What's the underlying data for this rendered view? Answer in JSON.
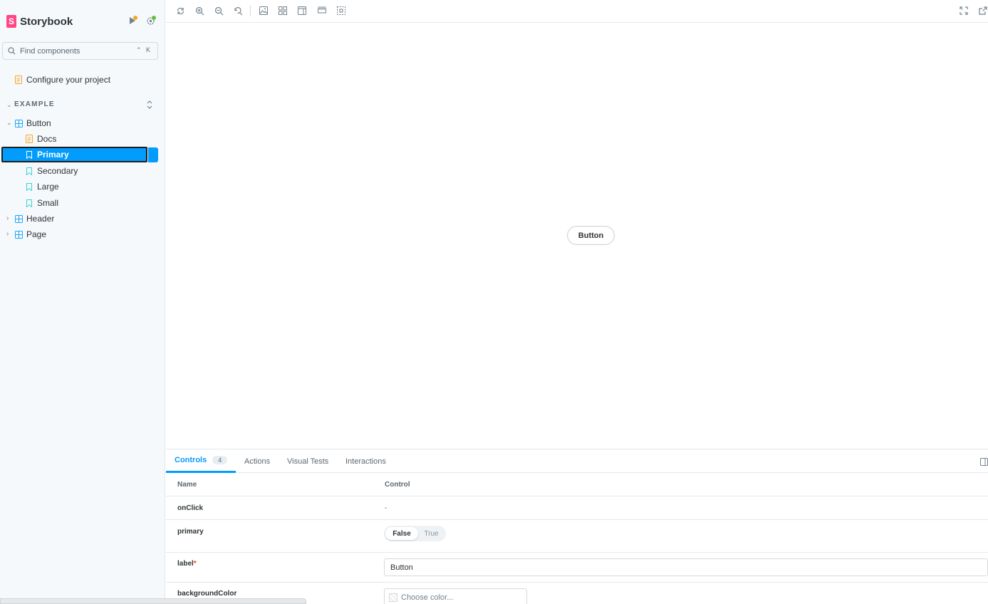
{
  "brand": {
    "name": "Storybook",
    "logo_letter": "S",
    "accent": "#ff4785"
  },
  "search": {
    "placeholder": "Find components",
    "shortcut": "⌃ K"
  },
  "sidebar": {
    "configure_label": "Configure your project",
    "section_label": "EXAMPLE",
    "items": [
      {
        "label": "Button",
        "kind": "component",
        "expanded": true
      },
      {
        "label": "Docs",
        "kind": "docs"
      },
      {
        "label": "Primary",
        "kind": "story",
        "selected": true
      },
      {
        "label": "Secondary",
        "kind": "story"
      },
      {
        "label": "Large",
        "kind": "story"
      },
      {
        "label": "Small",
        "kind": "story"
      },
      {
        "label": "Header",
        "kind": "component",
        "expanded": false
      },
      {
        "label": "Page",
        "kind": "component",
        "expanded": false
      }
    ]
  },
  "canvas": {
    "button_label": "Button"
  },
  "panel": {
    "tabs": [
      {
        "label": "Controls",
        "count": "4",
        "active": true
      },
      {
        "label": "Actions"
      },
      {
        "label": "Visual Tests"
      },
      {
        "label": "Interactions"
      }
    ],
    "columns": {
      "name": "Name",
      "control": "Control"
    },
    "rows": {
      "onclick": {
        "name": "onClick",
        "value": "-"
      },
      "primary": {
        "name": "primary",
        "false_label": "False",
        "true_label": "True",
        "selected": "False"
      },
      "label": {
        "name": "label",
        "required_mark": "*",
        "value": "Button"
      },
      "background": {
        "name": "backgroundColor",
        "placeholder": "Choose color..."
      }
    }
  },
  "colors": {
    "selection": "#029cfd",
    "accent_pink": "#ff4785",
    "status_orange": "#f5a623",
    "status_green": "#66bf3c"
  }
}
